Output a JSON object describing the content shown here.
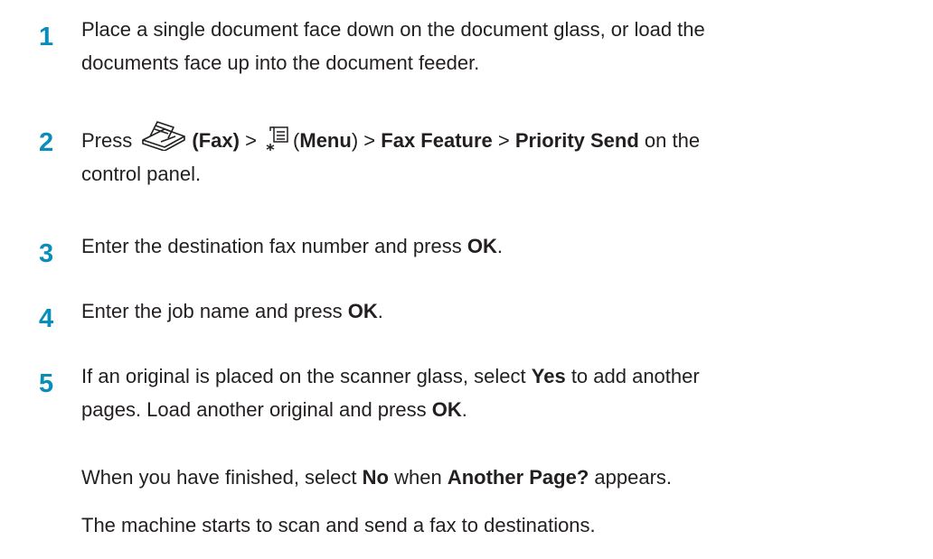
{
  "steps": [
    {
      "number": "1",
      "line1": "Place a single document face down on the document glass, or load the",
      "line2": "documents face up into the document feeder."
    },
    {
      "number": "2",
      "prefix": "Press",
      "fax_label": "(Fax)",
      "sep1": ">",
      "menu_open": "(",
      "menu_label": "Menu",
      "menu_close": ")",
      "sep2": ">",
      "fax_feature": "Fax Feature",
      "sep3": ">",
      "priority_send": "Priority Send",
      "suffix": "on the",
      "line2": "control panel."
    },
    {
      "number": "3",
      "text": "Enter the destination fax number and press",
      "ok": "OK",
      "period": "."
    },
    {
      "number": "4",
      "text": "Enter the job name and press",
      "ok": "OK",
      "period": "."
    },
    {
      "number": "5",
      "line1_pre": "If an original is placed on the scanner glass, select",
      "yes": "Yes",
      "line1_post": "to add another",
      "line2_pre": "pages. Load another original and press",
      "ok": "OK",
      "period": ".",
      "para1_pre": "When you have finished, select",
      "no": "No",
      "para1_mid": "when",
      "another_page": "Another Page?",
      "para1_post": "appears.",
      "para2": "The machine starts to scan and send a fax to destinations."
    }
  ],
  "icons": {
    "fax": "fax-icon",
    "menu": "menu-icon"
  },
  "colors": {
    "step_number": "#0a8db8",
    "text": "#231f20"
  }
}
